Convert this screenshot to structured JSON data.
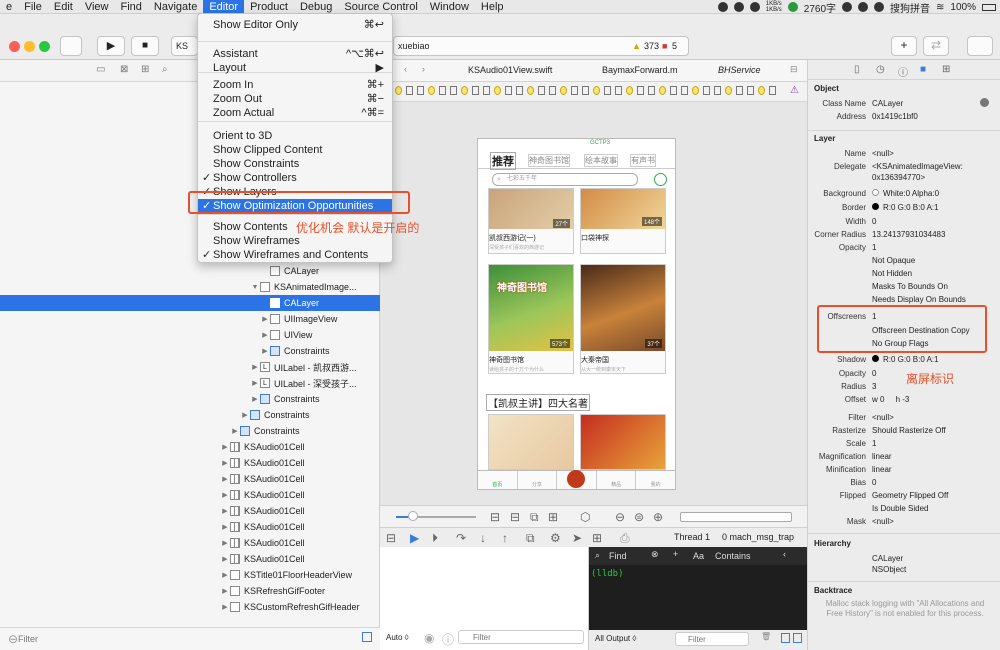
{
  "menubar": {
    "items": [
      "Edit",
      "View",
      "Find",
      "Navigate",
      "Editor",
      "Product",
      "Debug",
      "Source Control",
      "Window",
      "Help"
    ],
    "app_fragment": "e",
    "file": "File",
    "status": {
      "net_up": "1KB/s",
      "net_down": "1KB/s",
      "word_count": "2760字",
      "ime": "搜狗拼音",
      "battery": "100%"
    }
  },
  "toolbar": {
    "scheme_fragment": "KS",
    "search_fragment": "xuebiao",
    "warnings": "373",
    "errors": "5"
  },
  "editor_menu": {
    "items": [
      {
        "label": "Show Editor Only",
        "shortcut": "⌘↩"
      },
      {
        "label": "Assistant",
        "shortcut": "^⌥⌘↩"
      },
      {
        "label": "Layout",
        "shortcut": "▶"
      },
      {
        "label": "Zoom In",
        "shortcut": "⌘+"
      },
      {
        "label": "Zoom Out",
        "shortcut": "⌘−"
      },
      {
        "label": "Zoom Actual",
        "shortcut": "^⌘="
      },
      {
        "label": "Orient to 3D",
        "shortcut": ""
      },
      {
        "label": "Show Clipped Content",
        "shortcut": ""
      },
      {
        "label": "Show Constraints",
        "shortcut": ""
      },
      {
        "label": "Show Controllers",
        "shortcut": "",
        "checked": true
      },
      {
        "label": "Show Layers",
        "shortcut": "",
        "checked": true
      },
      {
        "label": "Show Optimization Opportunities",
        "shortcut": "",
        "checked": true,
        "highlighted": true
      },
      {
        "label": "Show Contents",
        "shortcut": ""
      },
      {
        "label": "Show Wireframes",
        "shortcut": ""
      },
      {
        "label": "Show Wireframes and Contents",
        "shortcut": "",
        "checked": true
      }
    ],
    "checkmark": "✓"
  },
  "annotations": {
    "optimization": "优化机会 默认是开启的",
    "offscreen": "离屏标识"
  },
  "navigator": {
    "rows": [
      {
        "label": "CALayer",
        "indent": 270,
        "tri": "",
        "icon": "plain"
      },
      {
        "label": "KSAnimatedImage...",
        "indent": 260,
        "tri": "▼",
        "icon": "plain"
      },
      {
        "label": "CALayer",
        "indent": 270,
        "tri": "",
        "icon": "plain",
        "selected": true
      },
      {
        "label": "UIImageView",
        "indent": 270,
        "tri": "▶",
        "icon": "plain"
      },
      {
        "label": "UIView",
        "indent": 270,
        "tri": "▶",
        "icon": "plain"
      },
      {
        "label": "Constraints",
        "indent": 270,
        "tri": "▶",
        "icon": "blue"
      },
      {
        "label": "UILabel - 凯叔西游...",
        "indent": 260,
        "tri": "▶",
        "icon": "L"
      },
      {
        "label": "UILabel - 深受孩子...",
        "indent": 260,
        "tri": "▶",
        "icon": "L"
      },
      {
        "label": "Constraints",
        "indent": 260,
        "tri": "▶",
        "icon": "blue"
      },
      {
        "label": "Constraints",
        "indent": 250,
        "tri": "▶",
        "icon": "blue"
      },
      {
        "label": "Constraints",
        "indent": 240,
        "tri": "▶",
        "icon": "blue"
      },
      {
        "label": "KSAudio01Cell",
        "indent": 230,
        "tri": "▶",
        "icon": "grid"
      },
      {
        "label": "KSAudio01Cell",
        "indent": 230,
        "tri": "▶",
        "icon": "grid"
      },
      {
        "label": "KSAudio01Cell",
        "indent": 230,
        "tri": "▶",
        "icon": "grid"
      },
      {
        "label": "KSAudio01Cell",
        "indent": 230,
        "tri": "▶",
        "icon": "grid"
      },
      {
        "label": "KSAudio01Cell",
        "indent": 230,
        "tri": "▶",
        "icon": "grid"
      },
      {
        "label": "KSAudio01Cell",
        "indent": 230,
        "tri": "▶",
        "icon": "grid"
      },
      {
        "label": "KSAudio01Cell",
        "indent": 230,
        "tri": "▶",
        "icon": "grid"
      },
      {
        "label": "KSAudio01Cell",
        "indent": 230,
        "tri": "▶",
        "icon": "grid"
      },
      {
        "label": "KSTitle01FloorHeaderView",
        "indent": 230,
        "tri": "▶",
        "icon": "plain"
      },
      {
        "label": "KSRefreshGifFooter",
        "indent": 230,
        "tri": "▶",
        "icon": "plain"
      },
      {
        "label": "KSCustomRefreshGifHeader",
        "indent": 230,
        "tri": "▶",
        "icon": "plain"
      }
    ],
    "filter_placeholder": "Filter"
  },
  "tabs": [
    "KSAudio01View.swift",
    "BaymaxForward.m",
    "BHService"
  ],
  "phone": {
    "top_label": "GCTP3",
    "tabs": [
      "推荐",
      "神奇图书馆",
      "绘本故事",
      "有声书"
    ],
    "search_placeholder": "七彩五千年",
    "cards": [
      {
        "title": "凯叔西游记(一)",
        "sub": "深受孩子们喜欢的西游记",
        "badge": "27个"
      },
      {
        "title": "口袋神探",
        "sub": "",
        "badge": "148个"
      },
      {
        "title": "神奇图书馆",
        "sub": "读给孩子的十万个为什么",
        "badge": "573个",
        "art": "神奇图书馆"
      },
      {
        "title": "大秦帝国",
        "sub": "从大一统到秦末天下",
        "badge": "37个"
      }
    ],
    "section_title": "【凯叔主讲】四大名著",
    "bottom_tabs": [
      "首页",
      "分享",
      "",
      "精品",
      "我的"
    ]
  },
  "debug": {
    "thread": "Thread 1",
    "frame": "0 mach_msg_trap",
    "find_label": "Find",
    "aa": "Aa",
    "contains": "Contains",
    "prompt": "(lldb)",
    "auto": "Auto ◊",
    "filter_placeholder": "Filter",
    "all_output": "All Output ◊"
  },
  "inspector": {
    "object_title": "Object",
    "class_name_label": "Class Name",
    "class_name": "CALayer",
    "address_label": "Address",
    "address": "0x1419c1bf0",
    "layer_title": "Layer",
    "name_label": "Name",
    "name": "<null>",
    "delegate_label": "Delegate",
    "delegate": "<KSAnimatedImageView:",
    "delegate2": "0x136394770>",
    "background_label": "Background",
    "background": "White:0 Alpha:0",
    "border_label": "Border",
    "border": "R:0 G:0 B:0 A:1",
    "width_label": "Width",
    "width": "0",
    "corner_label": "Corner Radius",
    "corner": "13.24137931034483",
    "opacity_label": "Opacity",
    "opacity": "1",
    "flags": [
      "Not Opaque",
      "Not Hidden",
      "Masks To Bounds On",
      "Needs Display On Bounds"
    ],
    "offscreens_label": "Offscreens",
    "offscreens": "1",
    "offscreen_flags": [
      "Offscreen Destination Copy",
      "No Group Flags"
    ],
    "shadow_label": "Shadow",
    "shadow": "R:0 G:0 B:0 A:1",
    "sopacity_label": "Opacity",
    "sopacity": "0",
    "radius_label": "Radius",
    "radius": "3",
    "offset_label": "Offset",
    "offset": "w 0     h -3",
    "filter_label": "Filter",
    "filter": "<null>",
    "rasterize_label": "Rasterize",
    "rasterize": "Should Rasterize Off",
    "scale_label": "Scale",
    "scale": "1",
    "mag_label": "Magnification",
    "mag": "linear",
    "min_label": "Minification",
    "min": "linear",
    "bias_label": "Bias",
    "bias": "0",
    "flipped_label": "Flipped",
    "flipped": "Geometry Flipped Off",
    "flipped2": "Is Double Sided",
    "mask_label": "Mask",
    "mask": "<null>",
    "hierarchy_title": "Hierarchy",
    "hierarchy": [
      "CALayer",
      "NSObject"
    ],
    "backtrace_title": "Backtrace",
    "backtrace_msg": "Malloc stack logging with \"All Allocations and Free History\" is not enabled for this process."
  }
}
